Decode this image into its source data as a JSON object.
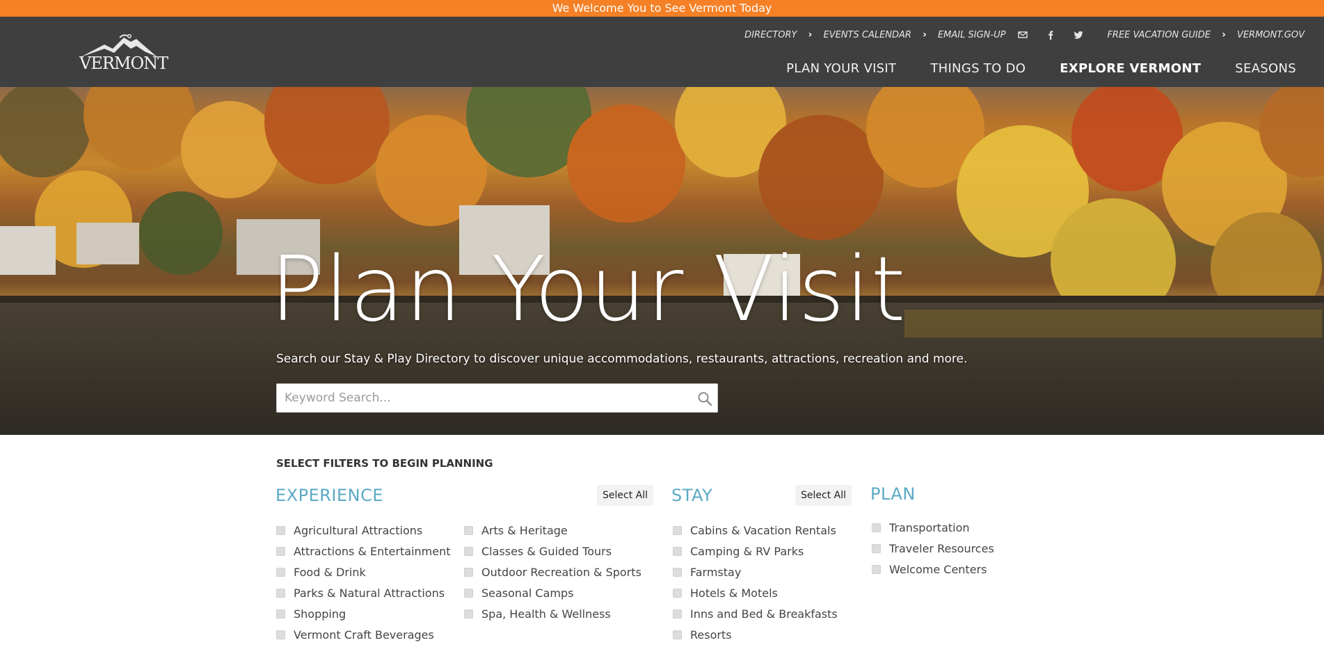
{
  "banner": {
    "text": "We Welcome You to See Vermont Today"
  },
  "brand": {
    "logo_text": "VERMONT"
  },
  "utility_nav": {
    "directory": "DIRECTORY",
    "events": "EVENTS CALENDAR",
    "email": "EMAIL SIGN-UP",
    "guide": "FREE VACATION GUIDE",
    "vtgov": "VERMONT.GOV",
    "icons": [
      "email-icon",
      "facebook-icon",
      "twitter-icon"
    ]
  },
  "main_nav": {
    "items": [
      {
        "label": "PLAN YOUR VISIT"
      },
      {
        "label": "THINGS TO DO"
      },
      {
        "label": "EXPLORE VERMONT"
      },
      {
        "label": "SEASONS"
      }
    ],
    "active": "EXPLORE VERMONT"
  },
  "hero": {
    "title": "Plan Your Visit",
    "subtitle": "Search our Stay & Play Directory to discover unique accommodations, restaurants, attractions, recreation and more.",
    "search_placeholder": "Keyword Search..."
  },
  "filters": {
    "title": "SELECT FILTERS TO BEGIN PLANNING",
    "select_all_label": "Select All",
    "experience": {
      "heading": "EXPERIENCE",
      "col1": [
        "Agricultural Attractions",
        "Attractions & Entertainment",
        "Food & Drink",
        "Parks & Natural Attractions",
        "Shopping",
        "Vermont Craft Beverages"
      ],
      "col2": [
        "Arts & Heritage",
        "Classes & Guided Tours",
        "Outdoor Recreation & Sports",
        "Seasonal Camps",
        "Spa, Health & Wellness"
      ]
    },
    "stay": {
      "heading": "STAY",
      "items": [
        "Cabins & Vacation Rentals",
        "Camping & RV Parks",
        "Farmstay",
        "Hotels & Motels",
        "Inns and Bed & Breakfasts",
        "Resorts"
      ]
    },
    "plan": {
      "heading": "PLAN",
      "items": [
        "Transportation",
        "Traveler Resources",
        "Welcome Centers"
      ]
    }
  },
  "colors": {
    "banner": "#f58025",
    "header": "#3f3f40",
    "heading_accent": "#5aa9c4"
  }
}
